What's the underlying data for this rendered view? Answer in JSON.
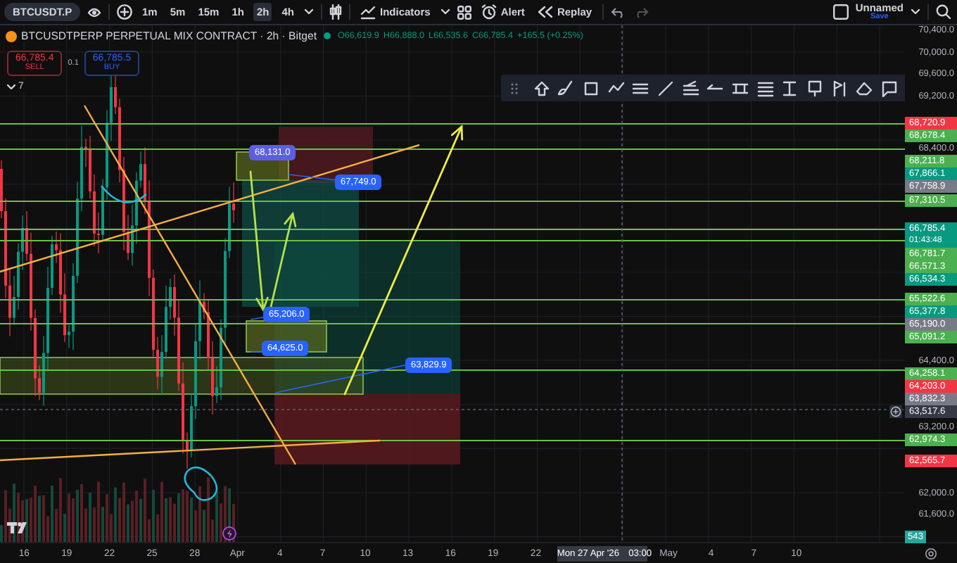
{
  "toolbar": {
    "symbol": "BTCUSDT.P",
    "intervals": [
      {
        "label": "1m",
        "selected": false
      },
      {
        "label": "5m",
        "selected": false
      },
      {
        "label": "15m",
        "selected": false
      },
      {
        "label": "1h",
        "selected": false
      },
      {
        "label": "2h",
        "selected": true
      },
      {
        "label": "4h",
        "selected": false
      }
    ],
    "indicators": "Indicators",
    "alert": "Alert",
    "replay": "Replay",
    "layout_name": "Unnamed",
    "save": "Save"
  },
  "legend": {
    "title": "BTCUSDTPERP PERPETUAL MIX CONTRACT · 2h · Bitget",
    "values": [
      {
        "key": "O",
        "value": "66,619.9"
      },
      {
        "key": "H",
        "value": "66,888.0"
      },
      {
        "key": "L",
        "value": "66,535.6"
      },
      {
        "key": "C",
        "value": "66,785.4"
      }
    ],
    "change": "+165.5 (+0.25%)"
  },
  "order": {
    "sell_price": "66,785.4",
    "sell_label": "SELL",
    "spread": "0.1",
    "buy_price": "66,785.5",
    "buy_label": "BUY"
  },
  "indicator_count": "7",
  "chart_labels": [
    {
      "text": "68,131.0",
      "color": "#5b5fe0"
    },
    {
      "text": "67,749.0",
      "color": "#2962ff"
    },
    {
      "text": "65,206.0",
      "color": "#2962ff"
    },
    {
      "text": "64,625.0",
      "color": "#2962ff"
    },
    {
      "text": "63,829.9",
      "color": "#2962ff"
    }
  ],
  "price_axis": [
    {
      "text": "70,400.0",
      "kind": "tick"
    },
    {
      "text": "70,000.0",
      "kind": "tick"
    },
    {
      "text": "69,600.0",
      "kind": "tick"
    },
    {
      "text": "69,200.0",
      "kind": "tick"
    },
    {
      "text": "68,720.9",
      "kind": "badge",
      "color": "#f23645"
    },
    {
      "text": "68,678.4",
      "kind": "badge",
      "color": "#4caf50"
    },
    {
      "text": "68,400.0",
      "kind": "tick"
    },
    {
      "text": "68,211.8",
      "kind": "badge",
      "color": "#4caf50"
    },
    {
      "text": "67,866.1",
      "kind": "badge",
      "color": "#089981"
    },
    {
      "text": "67,758.9",
      "kind": "badge",
      "color": "#787b86"
    },
    {
      "text": "67,310.5",
      "kind": "badge",
      "color": "#4caf50"
    },
    {
      "text": "66,785.4",
      "kind": "badge",
      "color": "#089981",
      "countdown": "01:43:48"
    },
    {
      "text": "66,781.7",
      "kind": "badge",
      "color": "#4caf50"
    },
    {
      "text": "66,571.3",
      "kind": "badge",
      "color": "#4caf50"
    },
    {
      "text": "66,534.3",
      "kind": "badge",
      "color": "#089981"
    },
    {
      "text": "65,522.6",
      "kind": "badge",
      "color": "#4caf50"
    },
    {
      "text": "65,377.8",
      "kind": "badge",
      "color": "#089981"
    },
    {
      "text": "65,190.0",
      "kind": "badge",
      "color": "#787b86"
    },
    {
      "text": "65,091.2",
      "kind": "badge",
      "color": "#4caf50"
    },
    {
      "text": "64,400.0",
      "kind": "tick"
    },
    {
      "text": "64,258.1",
      "kind": "badge",
      "color": "#4caf50"
    },
    {
      "text": "64,203.0",
      "kind": "badge",
      "color": "#f23645"
    },
    {
      "text": "63,832.3",
      "kind": "badge",
      "color": "#787b86"
    },
    {
      "text": "63,517.6",
      "kind": "crosshair"
    },
    {
      "text": "63,200.0",
      "kind": "tick"
    },
    {
      "text": "62,974.3",
      "kind": "badge",
      "color": "#4caf50"
    },
    {
      "text": "62,565.7",
      "kind": "badge",
      "color": "#f23645"
    },
    {
      "text": "62,000.0",
      "kind": "tick"
    },
    {
      "text": "61,600.0",
      "kind": "tick"
    }
  ],
  "volume_badge": "543",
  "time_axis": [
    {
      "text": "16",
      "kind": "date"
    },
    {
      "text": "19",
      "kind": "date"
    },
    {
      "text": "22",
      "kind": "date"
    },
    {
      "text": "25",
      "kind": "date"
    },
    {
      "text": "28",
      "kind": "date"
    },
    {
      "text": "Apr",
      "kind": "date"
    },
    {
      "text": "4",
      "kind": "date"
    },
    {
      "text": "7",
      "kind": "date"
    },
    {
      "text": "10",
      "kind": "date"
    },
    {
      "text": "13",
      "kind": "date"
    },
    {
      "text": "16",
      "kind": "date"
    },
    {
      "text": "19",
      "kind": "date"
    },
    {
      "text": "22",
      "kind": "date"
    },
    {
      "text": "Mon 27 Apr '26",
      "kind": "crosshair",
      "time": "03:00"
    },
    {
      "text": "May",
      "kind": "date"
    },
    {
      "text": "4",
      "kind": "date"
    },
    {
      "text": "7",
      "kind": "date"
    },
    {
      "text": "10",
      "kind": "date"
    }
  ]
}
